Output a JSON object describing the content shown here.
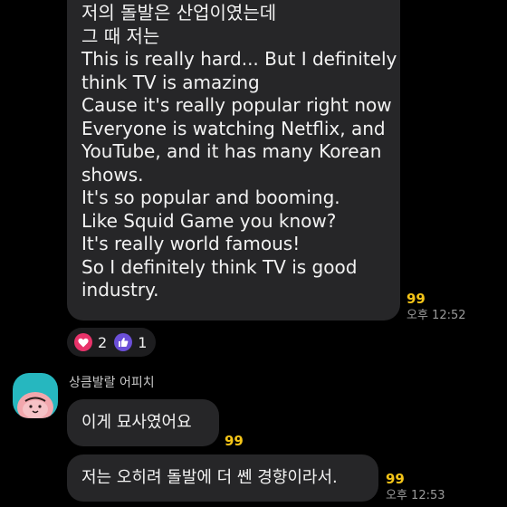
{
  "messages": [
    {
      "lines": [
        "저의 돌발은 산업이였는데",
        "그 때 저는",
        "This is really hard... But I definitely",
        "think TV is amazing",
        "Cause it's really popular right now",
        "Everyone is watching Netflix, and",
        "YouTube, and it has many Korean",
        "shows.",
        "It's so popular and booming.",
        "Like Squid Game you know?",
        "It's really world famous!",
        "So I definitely think TV is good",
        "industry."
      ],
      "unread": "99",
      "time": "오후 12:52",
      "reactions": [
        {
          "icon": "heart-icon",
          "count": "2",
          "color": "#e8336a"
        },
        {
          "icon": "thumbs-up-icon",
          "count": "1",
          "color": "#6b4fd8"
        }
      ]
    },
    {
      "text": "이게 묘사였어요",
      "unread": "99"
    },
    {
      "text": "저는 오히려 돌발에 더 쎈 경향이라서.",
      "unread": "99",
      "time": "오후 12:53"
    }
  ],
  "sender": {
    "name": "상큼발랄 어피치",
    "avatar_icon": "apeach-avatar-icon",
    "avatar_bg": "#26b7bf"
  },
  "colors": {
    "background": "#000000",
    "bubble": "#262628",
    "unread": "#f5c518",
    "time": "#9a9a9a"
  }
}
